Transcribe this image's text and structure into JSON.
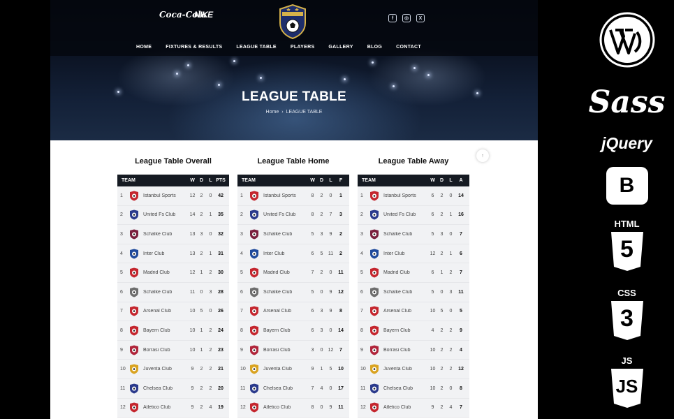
{
  "sponsors": {
    "coca_cola": "Coca-Cola",
    "nike": "NIKE"
  },
  "nav": {
    "items": [
      "HOME",
      "FIXTURES & RESULTS",
      "LEAGUE TABLE",
      "PLAYERS",
      "GALLERY",
      "BLOG",
      "CONTACT"
    ]
  },
  "hero": {
    "title": "LEAGUE TABLE",
    "breadcrumb_home": "Home",
    "breadcrumb_current": "LEAGUE TABLE"
  },
  "colors": {
    "header_dark": "#151a22",
    "row_bg": "#f1f2f4",
    "text": "#444444"
  },
  "tables": [
    {
      "title": "League Table Overall",
      "headers": [
        "TEAM",
        "W",
        "D",
        "L",
        "PTS"
      ],
      "rows": [
        [
          "1",
          "Istanbul Sports",
          "12",
          "2",
          "0",
          "42"
        ],
        [
          "2",
          "United Fs Club",
          "14",
          "2",
          "1",
          "35"
        ],
        [
          "3",
          "Schalke Club",
          "13",
          "3",
          "0",
          "32"
        ],
        [
          "4",
          "Inter Club",
          "13",
          "2",
          "1",
          "31"
        ],
        [
          "5",
          "Madrid Club",
          "12",
          "1",
          "2",
          "30"
        ],
        [
          "6",
          "Schalke Club",
          "11",
          "0",
          "3",
          "28"
        ],
        [
          "7",
          "Arsenal Club",
          "10",
          "5",
          "0",
          "26"
        ],
        [
          "8",
          "Bayern Club",
          "10",
          "1",
          "2",
          "24"
        ],
        [
          "9",
          "Borrasi Club",
          "10",
          "1",
          "2",
          "23"
        ],
        [
          "10",
          "Juventa Club",
          "9",
          "2",
          "2",
          "21"
        ],
        [
          "11",
          "Chelsea Club",
          "9",
          "2",
          "2",
          "20"
        ],
        [
          "12",
          "Atletico Club",
          "9",
          "2",
          "4",
          "19"
        ]
      ]
    },
    {
      "title": "League Table Home",
      "headers": [
        "TEAM",
        "W",
        "D",
        "L",
        "F"
      ],
      "rows": [
        [
          "1",
          "Istanbul Sports",
          "8",
          "2",
          "0",
          "1"
        ],
        [
          "2",
          "United Fs Club",
          "8",
          "2",
          "7",
          "3"
        ],
        [
          "3",
          "Schalke Club",
          "5",
          "3",
          "9",
          "2"
        ],
        [
          "4",
          "Inter Club",
          "6",
          "5",
          "11",
          "2"
        ],
        [
          "5",
          "Madrid Club",
          "7",
          "2",
          "0",
          "11"
        ],
        [
          "6",
          "Schalke Club",
          "5",
          "0",
          "9",
          "12"
        ],
        [
          "7",
          "Arsenal Club",
          "6",
          "3",
          "9",
          "8"
        ],
        [
          "8",
          "Bayern Club",
          "6",
          "3",
          "0",
          "14"
        ],
        [
          "9",
          "Borrasi Club",
          "3",
          "0",
          "12",
          "7"
        ],
        [
          "10",
          "Juventa Club",
          "9",
          "1",
          "5",
          "10"
        ],
        [
          "11",
          "Chelsea Club",
          "7",
          "4",
          "0",
          "17"
        ],
        [
          "12",
          "Atletico Club",
          "8",
          "0",
          "9",
          "11"
        ]
      ]
    },
    {
      "title": "League Table Away",
      "headers": [
        "TEAM",
        "W",
        "D",
        "L",
        "A"
      ],
      "rows": [
        [
          "1",
          "Istanbul Sports",
          "6",
          "2",
          "0",
          "14"
        ],
        [
          "2",
          "United Fs Club",
          "6",
          "2",
          "1",
          "16"
        ],
        [
          "3",
          "Schalke Club",
          "5",
          "3",
          "0",
          "7"
        ],
        [
          "4",
          "Inter Club",
          "12",
          "2",
          "1",
          "6"
        ],
        [
          "5",
          "Madrid Club",
          "6",
          "1",
          "2",
          "7"
        ],
        [
          "6",
          "Schalke Club",
          "5",
          "0",
          "3",
          "11"
        ],
        [
          "7",
          "Arsenal Club",
          "10",
          "5",
          "0",
          "5"
        ],
        [
          "8",
          "Bayern Club",
          "4",
          "2",
          "2",
          "9"
        ],
        [
          "9",
          "Borrasi Club",
          "10",
          "2",
          "2",
          "4"
        ],
        [
          "10",
          "Juventa Club",
          "10",
          "2",
          "2",
          "12"
        ],
        [
          "11",
          "Chelsea Club",
          "10",
          "2",
          "0",
          "8"
        ],
        [
          "12",
          "Atletico Club",
          "9",
          "2",
          "4",
          "7"
        ]
      ]
    }
  ],
  "badges": [
    "#c4262e",
    "#2a3a8c",
    "#7a1f3d",
    "#1f4a9c",
    "#c4262e",
    "#6d6d6d",
    "#c4262e",
    "#c4262e",
    "#b0243a",
    "#d9a321",
    "#2a3a8c",
    "#c4262e"
  ],
  "tech_stack": {
    "sass": "Sass",
    "jquery": "jQuery",
    "bootstrap": "B",
    "html_label": "HTML",
    "html_num": "5",
    "css_label": "CSS",
    "css_num": "3",
    "js_label": "JS",
    "js_num": "JS"
  }
}
